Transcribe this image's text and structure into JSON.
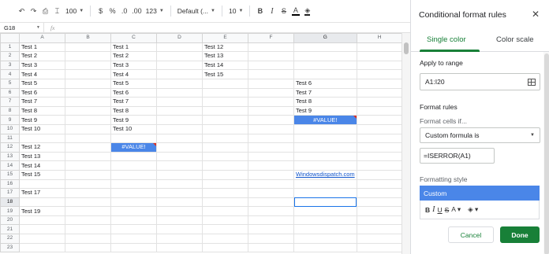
{
  "toolbar": {
    "zoom": "100",
    "currency": "$",
    "percent": "%",
    "decrease_decimal": ".0",
    "increase_decimal": ".00",
    "number_format": "123",
    "font": "Default (...",
    "font_size": "10",
    "bold": "B",
    "italic": "I",
    "strikethrough": "S",
    "text_color": "A"
  },
  "formula_bar": {
    "name_box": "G18",
    "fx": "fx"
  },
  "sheet": {
    "columns": [
      "A",
      "B",
      "C",
      "D",
      "E",
      "F",
      "G",
      "H"
    ],
    "rows": [
      {
        "num": "1",
        "A": "Test 1",
        "C": "Test 1",
        "E": "Test 12",
        "G": ""
      },
      {
        "num": "2",
        "A": "Test 2",
        "C": "Test 2",
        "E": "Test 13",
        "G": ""
      },
      {
        "num": "3",
        "A": "Test 3",
        "C": "Test 3",
        "E": "Test 14",
        "G": ""
      },
      {
        "num": "4",
        "A": "Test 4",
        "C": "Test 4",
        "E": "Test 15",
        "G": ""
      },
      {
        "num": "5",
        "A": "Test 5",
        "C": "Test 5",
        "E": "",
        "G": "Test 6"
      },
      {
        "num": "6",
        "A": "Test 6",
        "C": "Test 6",
        "E": "",
        "G": "Test 7"
      },
      {
        "num": "7",
        "A": "Test 7",
        "C": "Test 7",
        "E": "",
        "G": "Test 8"
      },
      {
        "num": "8",
        "A": "Test 8",
        "C": "Test 8",
        "E": "",
        "G": "Test 9"
      },
      {
        "num": "9",
        "A": "Test 9",
        "C": "Test 9",
        "E": "",
        "G": "#VALUE!"
      },
      {
        "num": "10",
        "A": "Test 10",
        "C": "Test 10",
        "E": "",
        "G": ""
      },
      {
        "num": "11",
        "A": "",
        "C": "",
        "E": "",
        "G": ""
      },
      {
        "num": "12",
        "A": "Test 12",
        "C": "#VALUE!",
        "E": "",
        "G": ""
      },
      {
        "num": "13",
        "A": "Test 13",
        "C": "",
        "E": "",
        "G": ""
      },
      {
        "num": "14",
        "A": "Test 14",
        "C": "",
        "E": "",
        "G": ""
      },
      {
        "num": "15",
        "A": "Test 15",
        "C": "",
        "E": "",
        "G": "Windowsdispatch.com"
      },
      {
        "num": "16",
        "A": "",
        "C": "",
        "E": "",
        "G": ""
      },
      {
        "num": "17",
        "A": "Test 17",
        "C": "",
        "E": "",
        "G": ""
      },
      {
        "num": "18",
        "A": "",
        "C": "",
        "E": "",
        "G": ""
      },
      {
        "num": "19",
        "A": "Test 19",
        "C": "",
        "E": "",
        "G": ""
      },
      {
        "num": "20",
        "A": "",
        "C": "",
        "E": "",
        "G": ""
      },
      {
        "num": "21",
        "A": "",
        "C": "",
        "E": "",
        "G": ""
      },
      {
        "num": "22",
        "A": "",
        "C": "",
        "E": "",
        "G": ""
      },
      {
        "num": "23",
        "A": "",
        "C": "",
        "E": "",
        "G": ""
      }
    ]
  },
  "panel": {
    "title": "Conditional format rules",
    "tab_single": "Single color",
    "tab_scale": "Color scale",
    "apply_label": "Apply to range",
    "range": "A1:I20",
    "format_rules": "Format rules",
    "format_cells_if": "Format cells if...",
    "condition": "Custom formula is",
    "formula": "=ISERROR(A1)",
    "formatting_style": "Formatting style",
    "style_preview": "Custom",
    "cancel": "Cancel",
    "done": "Done"
  },
  "colors": {
    "accent_green": "#188038",
    "error_fill": "#4a86e8",
    "link": "#1155cc",
    "selection": "#1a73e8"
  }
}
